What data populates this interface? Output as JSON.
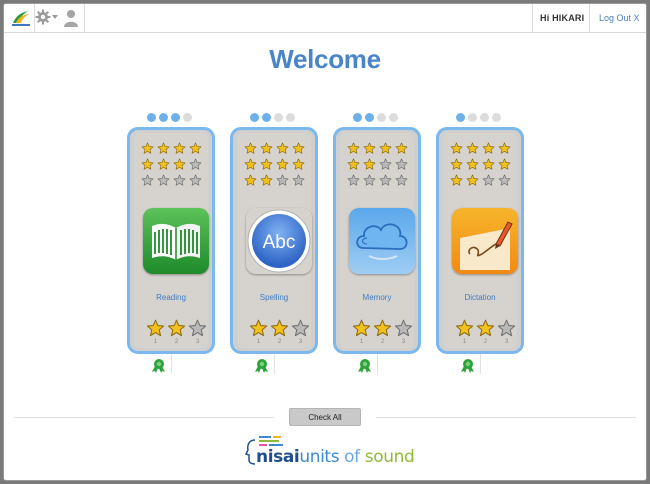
{
  "header": {
    "greeting": "Hi HIKARI",
    "logout_label": "Log Out X",
    "icons": [
      "app-logo-icon",
      "gear-icon",
      "chevron-down-icon",
      "user-icon"
    ]
  },
  "page": {
    "title": "Welcome"
  },
  "colors": {
    "card_border": "#7ab8ee",
    "dot_on": "#6eb1ea",
    "dot_off": "#dcdcdc",
    "star_gold": "#f3c01c",
    "star_grey": "#b9b9b9",
    "title": "#4a84c9",
    "ribbon": "#2fa33b"
  },
  "modules": [
    {
      "label": "Reading",
      "icon": "open-book-icon",
      "progress_dots": 3,
      "small_stars": [
        4,
        3,
        0
      ],
      "big_stars": 2
    },
    {
      "label": "Spelling",
      "icon": "abc-icon",
      "progress_dots": 2,
      "small_stars": [
        4,
        4,
        2
      ],
      "big_stars": 2
    },
    {
      "label": "Memory",
      "icon": "cloud-icon",
      "progress_dots": 2,
      "small_stars": [
        4,
        2,
        0
      ],
      "big_stars": 2
    },
    {
      "label": "Dictation",
      "icon": "pencil-paper-icon",
      "progress_dots": 1,
      "small_stars": [
        4,
        4,
        2
      ],
      "big_stars": 2
    }
  ],
  "star_numbers": [
    "1",
    "2",
    "3"
  ],
  "footer": {
    "check_all_label": "Check All",
    "brand": {
      "part1": "nisai",
      "part2": "units ",
      "part3": "of ",
      "part4": "sound"
    }
  }
}
